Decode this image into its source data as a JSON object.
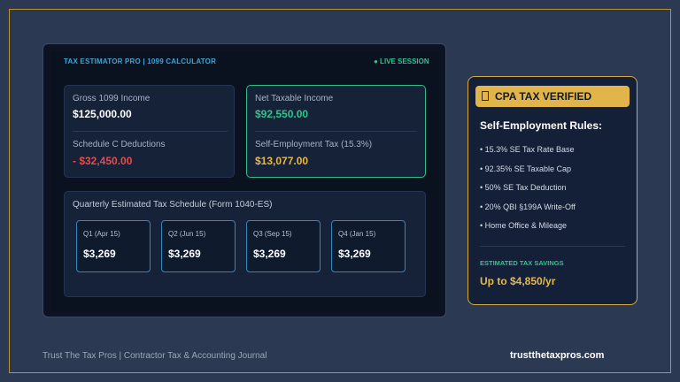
{
  "calculator": {
    "title": "TAX ESTIMATOR PRO | 1099 CALCULATOR",
    "status": "● LIVE SESSION",
    "gross_label": "Gross 1099 Income",
    "gross_value": "$125,000.00",
    "deductions_label": "Schedule C Deductions",
    "deductions_value": "- $32,450.00",
    "net_label": "Net Taxable Income",
    "net_value": "$92,550.00",
    "se_label": "Self-Employment Tax (15.3%)",
    "se_value": "$13,077.00",
    "quarterly_title": "Quarterly Estimated Tax Schedule (Form 1040-ES)",
    "quarters": [
      {
        "label": "Q1 (Apr 15)",
        "value": "$3,269"
      },
      {
        "label": "Q2 (Jun 15)",
        "value": "$3,269"
      },
      {
        "label": "Q3 (Sep 15)",
        "value": "$3,269"
      },
      {
        "label": "Q4 (Jan 15)",
        "value": "$3,269"
      }
    ]
  },
  "cpa": {
    "badge_icon": "lock-icon",
    "badge": "CPA TAX VERIFIED",
    "rules_title": "Self-Employment Rules:",
    "rules": [
      "• 15.3% SE Tax Rate Base",
      "• 92.35% SE Taxable Cap",
      "• 50% SE Tax Deduction",
      "• 20% QBI §199A Write-Off",
      "• Home Office & Mileage"
    ],
    "savings_label": "ESTIMATED TAX SAVINGS",
    "savings_value": "Up to $4,850/yr"
  },
  "footer": {
    "left": "Trust The Tax Pros | Contractor Tax & Accounting Journal",
    "right": "trustthetaxpros.com"
  },
  "colors": {
    "background": "#2b3a52",
    "accent_gold": "#d4a93e",
    "accent_green": "#2fc48d",
    "accent_blue": "#3aa6d8",
    "deduction_red": "#e84a4a"
  }
}
